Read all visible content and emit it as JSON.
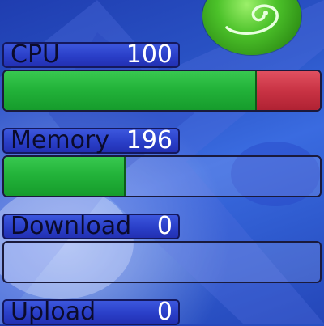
{
  "meters": [
    {
      "label": "CPU",
      "value": "100",
      "level": 0.8,
      "alert_level": 0.2
    },
    {
      "label": "Memory",
      "value": "196",
      "level": 0.385
    },
    {
      "label": "Download",
      "value": "0",
      "level": 0.0
    },
    {
      "label": "Upload",
      "value": "0",
      "level": 0.0
    }
  ],
  "colors": {
    "label_bg": "#2a3fc8",
    "bar_fill": "#23b33a",
    "bar_alert": "#c93344",
    "background": "#2b56c8"
  },
  "icons": {
    "logo": "suse-chameleon-logo-icon"
  }
}
